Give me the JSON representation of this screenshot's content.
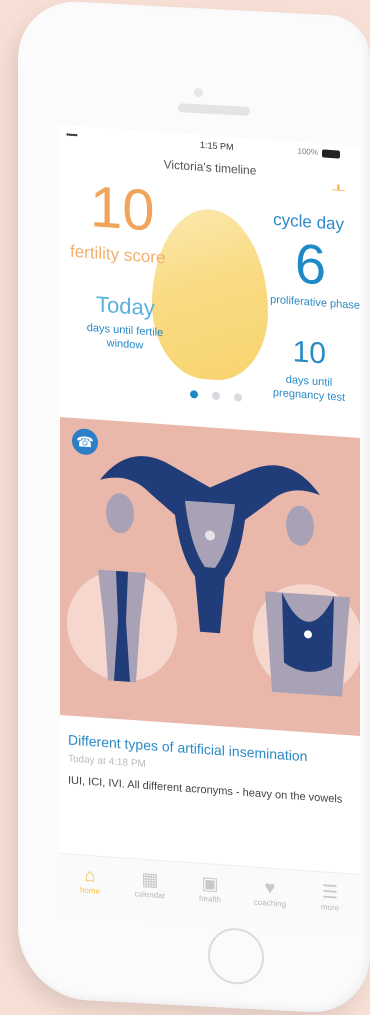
{
  "status": {
    "signal": "•••••",
    "time": "1:15 PM",
    "battery_label": "100%"
  },
  "nav": {
    "title": "Victoria's timeline",
    "add_label": "+"
  },
  "dashboard": {
    "fertility_score": "10",
    "fertility_score_label": "fertility score",
    "cycle_day_label": "cycle day",
    "cycle_day": "6",
    "phase": "proliferative phase",
    "fertile_window_value": "Today",
    "fertile_window_label": "days until fertile window",
    "pregnancy_test_days": "10",
    "pregnancy_test_label": "days until pregnancy test",
    "page_dots": 3,
    "active_dot": 0
  },
  "article": {
    "icon": "megaphone-icon",
    "title": "Different types of artificial insemination",
    "time": "Today at 4:18 PM",
    "snippet": "IUI, ICI, IVI. All different acronyms - heavy on the vowels"
  },
  "tabbar": {
    "items": [
      {
        "label": "home",
        "icon": "home-icon"
      },
      {
        "label": "calendar",
        "icon": "calendar-icon"
      },
      {
        "label": "health",
        "icon": "health-icon"
      },
      {
        "label": "coaching",
        "icon": "coaching-icon"
      },
      {
        "label": "more",
        "icon": "more-icon"
      }
    ],
    "active_index": 0
  },
  "colors": {
    "orange": "#f0a45c",
    "blue": "#1f88c6",
    "pink": "#eab8aa",
    "navy": "#203d7a",
    "grey_purple": "#9f99ad",
    "yellow": "#f3c24b"
  }
}
